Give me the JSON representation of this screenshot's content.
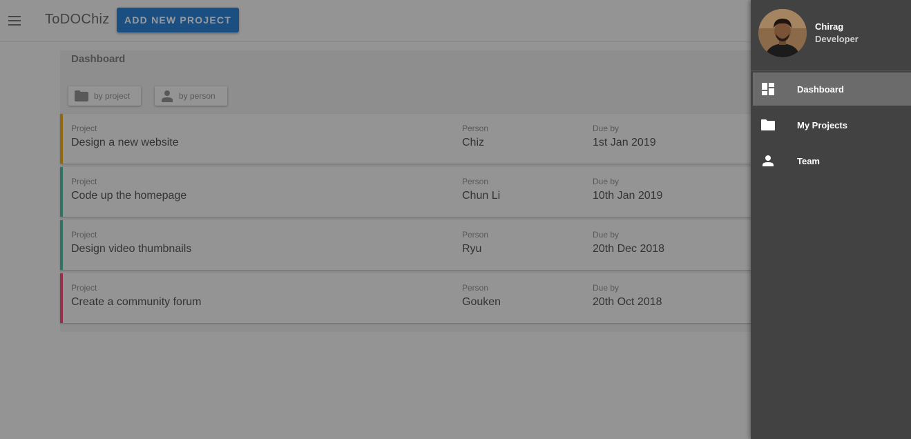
{
  "appbar": {
    "title": "ToDOChiz",
    "add_button": "ADD NEW PROJECT",
    "menu_icon": "hamburger-menu-icon"
  },
  "dashboard": {
    "title": "Dashboard",
    "sort_buttons": [
      {
        "label": "by project",
        "icon": "folder-icon"
      },
      {
        "label": "by person",
        "icon": "person-icon"
      }
    ],
    "column_labels": {
      "project": "Project",
      "person": "Person",
      "due": "Due by"
    },
    "projects": [
      {
        "title": "Design a new website",
        "person": "Chiz",
        "due": "1st Jan 2019",
        "status_color": "#f0a500"
      },
      {
        "title": "Code up the homepage",
        "person": "Chun Li",
        "due": "10th Jan 2019",
        "status_color": "#3cba9f"
      },
      {
        "title": "Design video thumbnails",
        "person": "Ryu",
        "due": "20th Dec 2018",
        "status_color": "#3cba9f"
      },
      {
        "title": "Create a community forum",
        "person": "Gouken",
        "due": "20th Oct 2018",
        "status_color": "#f83e70"
      }
    ]
  },
  "drawer": {
    "user": {
      "name": "Chirag",
      "role": "Developer"
    },
    "items": [
      {
        "label": "Dashboard",
        "icon": "dashboard-icon",
        "active": true
      },
      {
        "label": "My Projects",
        "icon": "folder-icon",
        "active": false
      },
      {
        "label": "Team",
        "icon": "person-icon",
        "active": false
      }
    ]
  },
  "colors": {
    "primary": "#1976d2",
    "drawer_bg": "#424242",
    "active_item_bg": "#6b6b6b"
  }
}
